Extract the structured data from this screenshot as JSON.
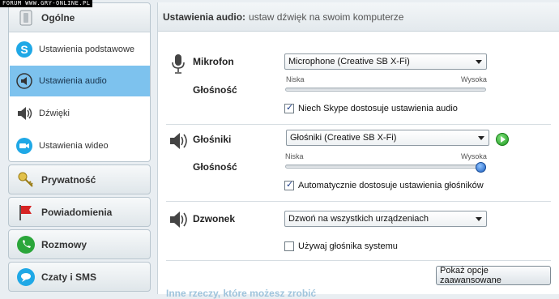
{
  "watermark": "FORUM WWW.GRY-ONLINE.PL",
  "sidebar": {
    "general": {
      "label": "Ogólne",
      "items": [
        {
          "label": "Ustawienia podstawowe",
          "icon": "skype-icon"
        },
        {
          "label": "Ustawienia audio",
          "icon": "audio-settings-icon",
          "active": true
        },
        {
          "label": "Dźwięki",
          "icon": "speaker-icon"
        },
        {
          "label": "Ustawienia wideo",
          "icon": "video-icon"
        }
      ]
    },
    "categories": [
      {
        "label": "Prywatność",
        "icon": "keys-icon"
      },
      {
        "label": "Powiadomienia",
        "icon": "flag-icon"
      },
      {
        "label": "Rozmowy",
        "icon": "phone-icon"
      },
      {
        "label": "Czaty i SMS",
        "icon": "chat-icon"
      }
    ]
  },
  "main": {
    "title": "Ustawienia audio:",
    "subtitle": "ustaw dźwięk na swoim komputerze",
    "microphone": {
      "label": "Mikrofon",
      "device": "Microphone (Creative SB X-Fi)",
      "volume_label": "Głośność",
      "low": "Niska",
      "high": "Wysoka",
      "auto_label": "Niech Skype dostosuje ustawienia audio",
      "auto_checked": true
    },
    "speakers": {
      "label": "Głośniki",
      "device": "Głośniki (Creative SB X-Fi)",
      "volume_label": "Głośność",
      "low": "Niska",
      "high": "Wysoka",
      "volume_level": 1.0,
      "auto_label": "Automatycznie dostosuje ustawienia głośników",
      "auto_checked": true
    },
    "ringer": {
      "label": "Dzwonek",
      "device": "Dzwoń na wszystkich urządzeniach",
      "system_speaker_label": "Używaj głośnika systemu",
      "system_speaker_checked": false
    },
    "advanced_button": "Pokaż opcje zaawansowane",
    "other_link": "Inne rzeczy, które możesz zrobić"
  },
  "colors": {
    "active_item": "#7dc2ee",
    "sidebar_bg": "#e9eef2",
    "play_green": "#1e9a20"
  }
}
